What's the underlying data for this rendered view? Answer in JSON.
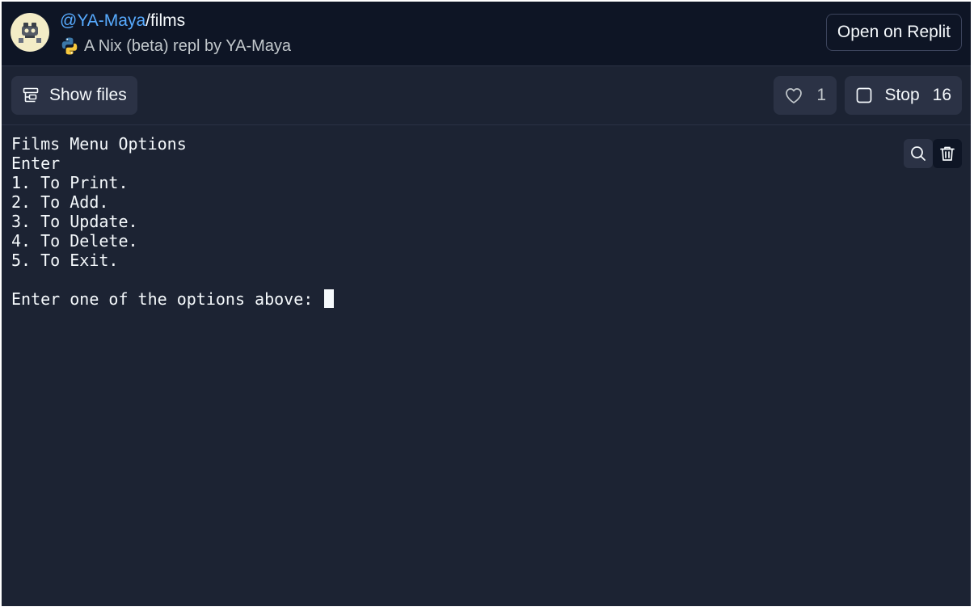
{
  "header": {
    "owner": "@YA-Maya",
    "separator": "/",
    "repl_name": "films",
    "subtitle": "A Nix (beta) repl by YA-Maya",
    "open_label": "Open on Replit"
  },
  "toolbar": {
    "show_files_label": "Show files",
    "like_count": "1",
    "stop_label": "Stop",
    "stop_count": "16"
  },
  "console": {
    "lines": [
      "Films Menu Options",
      "Enter",
      "1. To Print.",
      "2. To Add.",
      "3. To Update.",
      "4. To Delete.",
      "5. To Exit.",
      "",
      "Enter one of the options above: "
    ]
  },
  "icons": {
    "avatar": "avatar-icon",
    "language": "python-icon",
    "files": "files-icon",
    "like": "heart-icon",
    "stop": "stop-square-icon",
    "search": "search-icon",
    "clear": "trash-icon"
  },
  "colors": {
    "background": "#1c2333",
    "header_background": "#0e1525",
    "button_background": "#2b3245",
    "owner_link": "#57abff",
    "text": "#f5f9fc",
    "muted_text": "#c2c8cc"
  }
}
